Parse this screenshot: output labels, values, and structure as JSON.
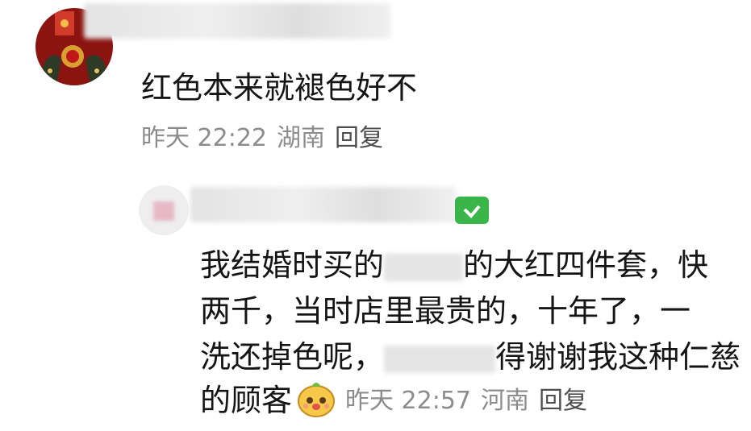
{
  "comment1": {
    "text": "红色本来就褪色好不",
    "time": "昨天 22:22",
    "location": "湖南",
    "reply_label": "回复"
  },
  "comment2": {
    "lines": [
      "我结婚时买的",
      "的大红四件套，快",
      "两千，当时店里最贵的，十年了，一",
      "洗还掉色呢，",
      "得谢谢我这种仁慈",
      "的顾客"
    ],
    "time": "昨天 22:57",
    "location": "河南",
    "reply_label": "回复"
  },
  "colors": {
    "text": "#151515",
    "meta": "#8c8c8c",
    "badge": "#3ab54a"
  }
}
